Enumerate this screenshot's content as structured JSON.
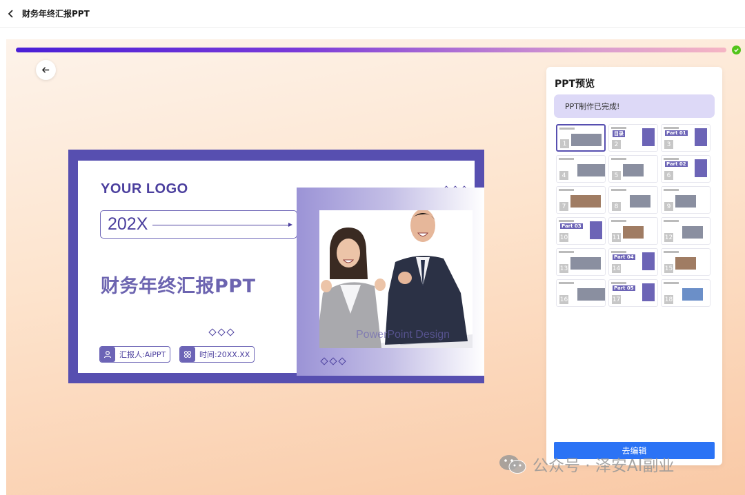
{
  "header": {
    "title": "财务年终汇报PPT"
  },
  "progress": {
    "fraction": 1.0,
    "complete": true
  },
  "colors": {
    "accent": "#574fb0",
    "progress_start": "#4a1fd6",
    "progress_end": "#f5b5c4",
    "success": "#52c41a",
    "button": "#2b73f5"
  },
  "slide": {
    "logo": "YOUR LOGO",
    "year": "202X",
    "title": "财务年终汇报PPT",
    "reporter": "汇报人:AiPPT",
    "time": "时间:20XX.XX",
    "design_text": "PowerPoint Design"
  },
  "preview": {
    "title": "PPT预览",
    "notice": "PPT制作已完成!",
    "thumbnails": [
      {
        "num": "1",
        "label": ""
      },
      {
        "num": "2",
        "label": "目录"
      },
      {
        "num": "3",
        "label": "Part 01"
      },
      {
        "num": "4",
        "label": ""
      },
      {
        "num": "5",
        "label": ""
      },
      {
        "num": "6",
        "label": "Part 02"
      },
      {
        "num": "7",
        "label": ""
      },
      {
        "num": "8",
        "label": ""
      },
      {
        "num": "9",
        "label": ""
      },
      {
        "num": "10",
        "label": "Part 03"
      },
      {
        "num": "11",
        "label": ""
      },
      {
        "num": "12",
        "label": ""
      },
      {
        "num": "13",
        "label": ""
      },
      {
        "num": "14",
        "label": "Part 04"
      },
      {
        "num": "15",
        "label": ""
      },
      {
        "num": "16",
        "label": ""
      },
      {
        "num": "17",
        "label": "Part 05"
      },
      {
        "num": "18",
        "label": ""
      }
    ],
    "edit_label": "去编辑"
  },
  "watermark": {
    "text": "公众号 · 泽安AI副业"
  },
  "icons": {
    "back": "chevron-left-icon",
    "circle_back": "arrow-left-icon",
    "done": "check-icon",
    "reporter": "user-icon",
    "time": "grid-icon",
    "wechat": "wechat-icon"
  }
}
